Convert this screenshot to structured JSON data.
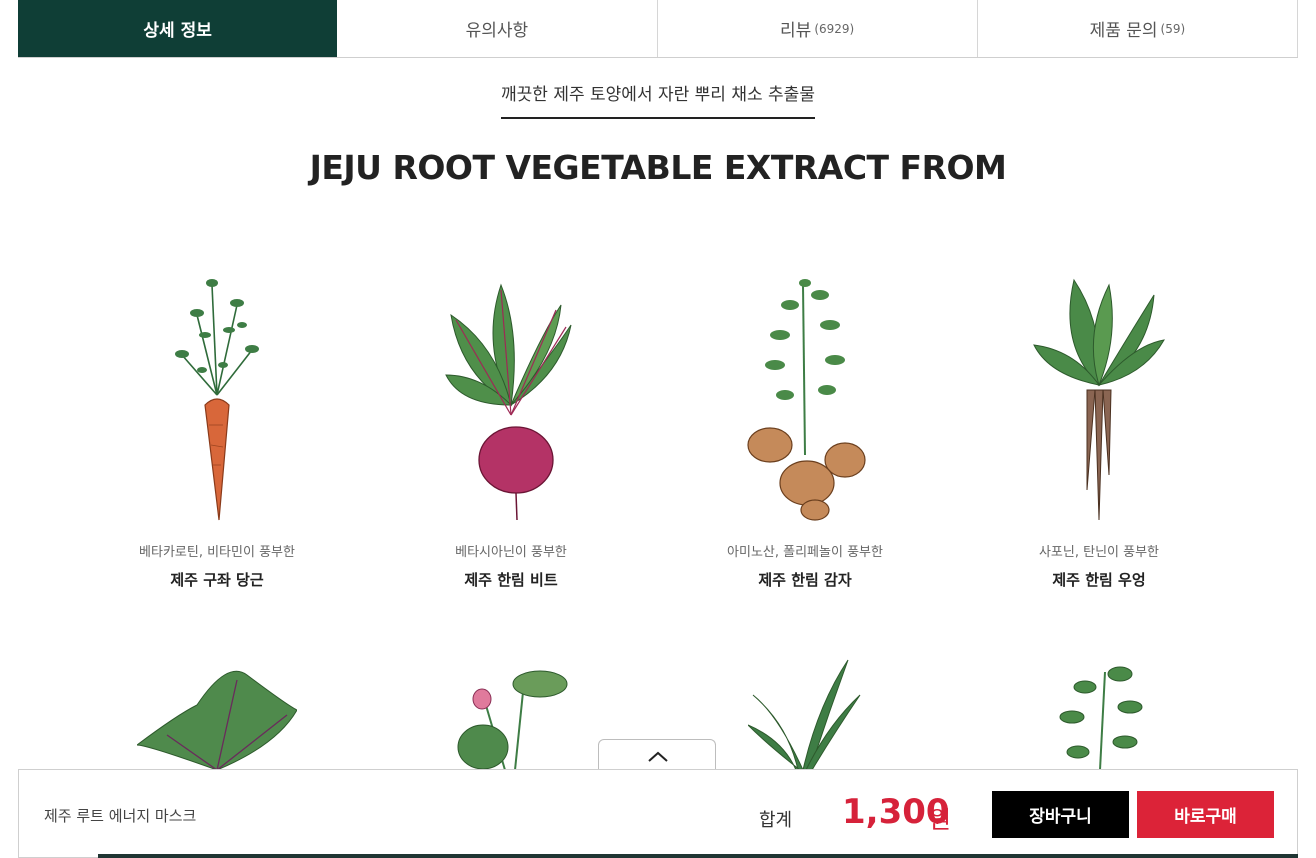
{
  "tabs": [
    {
      "label": "상세 정보",
      "count": ""
    },
    {
      "label": "유의사항",
      "count": ""
    },
    {
      "label": "리뷰",
      "count": "(6929)"
    },
    {
      "label": "제품 문의",
      "count": "(59)"
    }
  ],
  "subtitle": "깨끗한 제주 토양에서 자란 뿌리 채소 추출물",
  "title": "JEJU ROOT VEGETABLE EXTRACT FROM",
  "vegetables": [
    {
      "desc": "베타카로틴, 비타민이 풍부한",
      "name": "제주 구좌 당근",
      "icon": "carrot-icon"
    },
    {
      "desc": "베타시아닌이 풍부한",
      "name": "제주 한림 비트",
      "icon": "beet-icon"
    },
    {
      "desc": "아미노산, 폴리페놀이 풍부한",
      "name": "제주 한림 감자",
      "icon": "potato-icon"
    },
    {
      "desc": "사포닌, 탄닌이 풍부한",
      "name": "제주 한림 우엉",
      "icon": "burdock-icon"
    }
  ],
  "bottom_bar": {
    "product_name": "제주 루트 에너지 마스크",
    "total_label": "합계",
    "price": "1,300",
    "price_unit": "원",
    "cart_label": "장바구니",
    "buy_label": "바로구매"
  },
  "colors": {
    "tab_active": "#0f3e36",
    "price": "#d6223a",
    "buy_button": "#dc2338",
    "cart_button": "#000000"
  }
}
